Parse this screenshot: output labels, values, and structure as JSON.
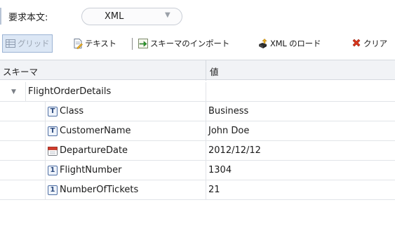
{
  "header": {
    "label": "要求本文:",
    "type_select": {
      "value": "XML"
    }
  },
  "toolbar": {
    "grid_label": "グリッド",
    "text_label": "テキスト",
    "import_schema_label": "スキーマのインポート",
    "load_xml_label": "XML のロード",
    "clear_label": "クリア"
  },
  "grid": {
    "columns": {
      "schema": "スキーマ",
      "value": "値"
    },
    "root": {
      "name": "FlightOrderDetails",
      "value": ""
    },
    "rows": [
      {
        "name": "Class",
        "value": "Business",
        "icon": "text-type-icon"
      },
      {
        "name": "CustomerName",
        "value": "John Doe",
        "icon": "text-type-icon"
      },
      {
        "name": "DepartureDate",
        "value": "2012/12/12",
        "icon": "calendar-type-icon"
      },
      {
        "name": "FlightNumber",
        "value": "1304",
        "icon": "number-type-icon"
      },
      {
        "name": "NumberOfTickets",
        "value": "21",
        "icon": "number-type-icon"
      }
    ]
  },
  "icons": {
    "text_type_glyph": "T",
    "number_type_glyph": "1"
  },
  "colors": {
    "active_button_bg": "#dce7f5",
    "import_arrow": "#2f9e2f",
    "clear_x": "#d9361c"
  }
}
